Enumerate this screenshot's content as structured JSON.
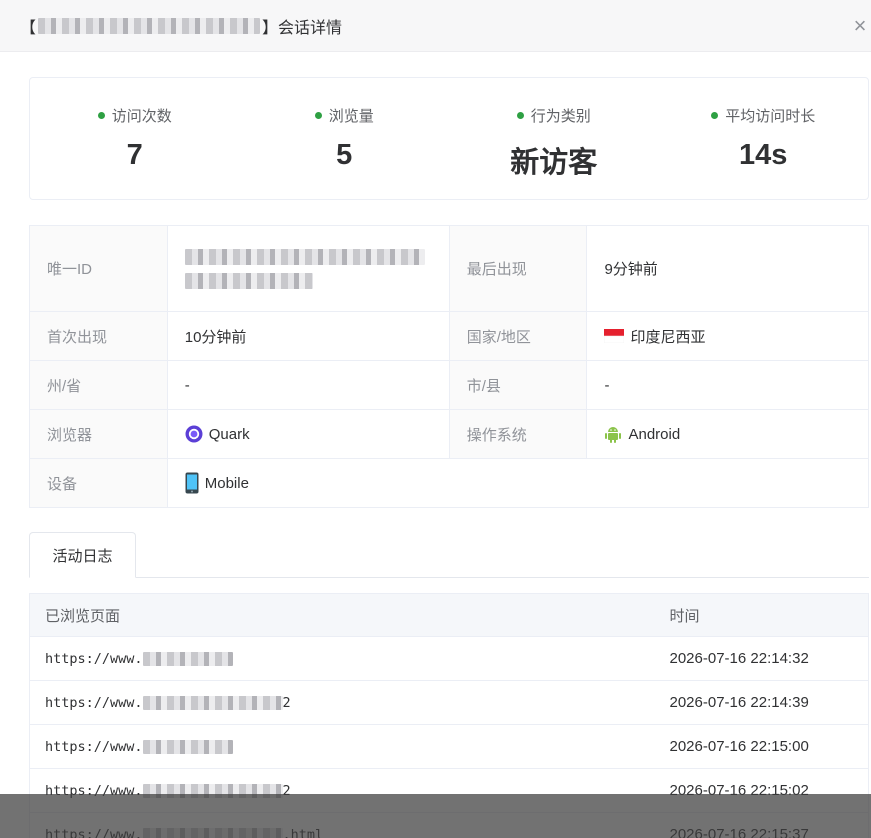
{
  "header": {
    "bracket_open": "【",
    "bracket_close": "】",
    "title_suffix": "会话详情",
    "close_glyph": "×"
  },
  "stats": [
    {
      "label": "访问次数",
      "value": "7"
    },
    {
      "label": "浏览量",
      "value": "5"
    },
    {
      "label": "行为类别",
      "value": "新访客"
    },
    {
      "label": "平均访问时长",
      "value": "14s"
    }
  ],
  "info": {
    "unique_id_label": "唯一ID",
    "last_seen_label": "最后出现",
    "last_seen_value": "9分钟前",
    "first_seen_label": "首次出现",
    "first_seen_value": "10分钟前",
    "country_label": "国家/地区",
    "country_value": "印度尼西亚",
    "country_icon": "indonesia-flag-icon",
    "state_label": "州/省",
    "state_value": "-",
    "city_label": "市/县",
    "city_value": "-",
    "browser_label": "浏览器",
    "browser_value": "Quark",
    "browser_icon": "quark-icon",
    "os_label": "操作系统",
    "os_value": "Android",
    "os_icon": "android-icon",
    "device_label": "设备",
    "device_value": "Mobile",
    "device_icon": "mobile-phone-icon"
  },
  "tabs": [
    {
      "label": "活动日志"
    }
  ],
  "log": {
    "col_page": "已浏览页面",
    "col_time": "时间",
    "rows": [
      {
        "url_prefix": "https://www.",
        "url_suffix": "",
        "time": "2026-07-16 22:14:32"
      },
      {
        "url_prefix": "https://www.",
        "url_suffix": "2",
        "time": "2026-07-16 22:14:39"
      },
      {
        "url_prefix": "https://www.",
        "url_suffix": "",
        "time": "2026-07-16 22:15:00"
      },
      {
        "url_prefix": "https://www.",
        "url_suffix": "2",
        "time": "2026-07-16 22:15:02"
      },
      {
        "url_prefix": "https://www.",
        "url_suffix": ".html",
        "time": "2026-07-16 22:15:37"
      }
    ]
  },
  "colors": {
    "dot": "#2ea043",
    "quark": "#5b3fd6",
    "android": "#8bc34a",
    "flag_red": "#e5202e"
  }
}
